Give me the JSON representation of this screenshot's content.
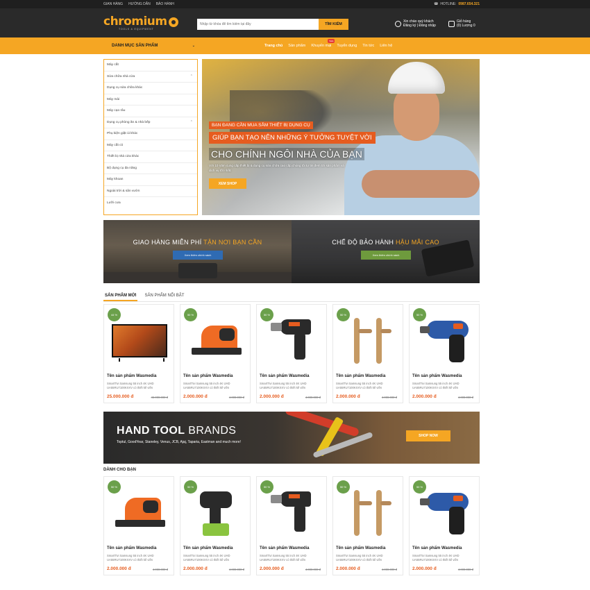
{
  "topbar": {
    "links": [
      "GIAN HÀNG",
      "HƯỚNG DẪN",
      "BẢO HÀNH"
    ],
    "hotline_label": "HOTLINE:",
    "hotline_number": "0987.654.321"
  },
  "header": {
    "logo_text": "chromium",
    "logo_tagline": "TOOLS & EQUIPMENT",
    "search_placeholder": "Nhập từ khóa để tìm kiếm tại đây",
    "search_button": "TÌM KIẾM",
    "account_line1": "Xin chào quý khách",
    "account_line2": "Đăng ký | Đăng nhập",
    "cart_line1": "Giỏ hàng",
    "cart_line2": "(0) Lượng 0"
  },
  "nav": {
    "category_label": "DANH MỤC SẢN PHẨM",
    "menu": [
      "Trang chủ",
      "Sản phẩm",
      "Khuyến mại",
      "Tuyển dụng",
      "Tin tức",
      "Liên hệ"
    ],
    "promo_badge": "Sale"
  },
  "categories": [
    {
      "label": "Máy cắt",
      "expandable": false
    },
    {
      "label": "Sửa chữa nhà cửa",
      "expandable": true
    },
    {
      "label": "Dụng cụ sửa chữa khác",
      "expandable": false
    },
    {
      "label": "Máy mài",
      "expandable": false
    },
    {
      "label": "Máy cạo râu",
      "expandable": false
    },
    {
      "label": "Dụng cụ phòng ăn & nhà bếp",
      "expandable": true
    },
    {
      "label": "Phụ kiện giặt ủi khác",
      "expandable": false
    },
    {
      "label": "Máy cắt cỏ",
      "expandable": false
    },
    {
      "label": "Thiết bị nhà cửa khác",
      "expandable": false
    },
    {
      "label": "Bộ dụng cụ đa năng",
      "expandable": false
    },
    {
      "label": "Máy khoan",
      "expandable": false
    },
    {
      "label": "Ngoài trời & sân vườn",
      "expandable": false
    },
    {
      "label": "Lưỡi cưa",
      "expandable": false
    }
  ],
  "hero": {
    "caption1": "BẠN ĐANG CẦN MUA SẮM THIẾT BỊ DỤNG CỤ",
    "caption2": "GIÚP BẠN TẠO NÊN NHỮNG Ý TƯỞNG TUYỆT VỜI",
    "caption3": "CHO CHÍNH NGÔI NHÀ CỦA BẠN",
    "description": "Với 10 năm cung cấp thiết bị & dụng cụ sửa chữa cao cấp,chúng tôi tự tin đem tới sản phẩm và dịch vụ tốt nhất.",
    "button": "XEM SHOP"
  },
  "banners": [
    {
      "title_plain": "GIAO HÀNG MIỄN PHÍ ",
      "title_accent": "TẬN NƠI BẠN CẦN",
      "button": "Xem thêm chính sách"
    },
    {
      "title_plain": "CHẾ ĐỘ BẢO HÀNH ",
      "title_accent": "HẬU MÃI CAO",
      "button": "Xem thêm chính sách"
    }
  ],
  "tabs": [
    "SẢN PHẨM MỚI",
    "SẢN PHẨM NỔI BẬT"
  ],
  "products_new": [
    {
      "discount": "44 %",
      "name": "Tên sản phẩm Wasmedia",
      "desc": "SmartTivi Samsung 55 inch 4K UHD UA55RU7100KXXV có thiết kế viền",
      "price": "25.000.000 đ",
      "old_price": "45.000.000 đ",
      "pic": "tv"
    },
    {
      "discount": "50 %",
      "name": "Tên sản phẩm Wasmedia",
      "desc": "SmartTivi Samsung 55 inch 4K UHD UA55RU7100KXXV có thiết kế viền",
      "price": "2.000.000 đ",
      "old_price": "4.000.000 đ",
      "pic": "planer"
    },
    {
      "discount": "50 %",
      "name": "Tên sản phẩm Wasmedia",
      "desc": "SmartTivi Samsung 55 inch 4K UHD UA55RU7100KXXV có thiết kế viền",
      "price": "2.000.000 đ",
      "old_price": "4.000.000 đ",
      "pic": "drill"
    },
    {
      "discount": "50 %",
      "name": "Tên sản phẩm Wasmedia",
      "desc": "SmartTivi Samsung 55 inch 4K UHD UA55RU7100KXXV có thiết kế viền",
      "price": "2.000.000 đ",
      "old_price": "4.000.000 đ",
      "pic": "key"
    },
    {
      "discount": "50 %",
      "name": "Tên sản phẩm Wasmedia",
      "desc": "SmartTivi Samsung 55 inch 4K UHD UA55RU7100KXXV có thiết kế viền",
      "price": "2.000.000 đ",
      "old_price": "4.000.000 đ",
      "pic": "screw"
    }
  ],
  "hand_banner": {
    "title_bold": "HAND TOOL",
    "title_light": " BRANDS",
    "subtitle": "Toptul, GoodYear, Staneley, Venus, JCB, Ajaj, Taparia, Eastman and much more!",
    "button": "SHOP NOW"
  },
  "section_for_you": "DÀNH CHO BẠN",
  "products_for_you": [
    {
      "discount": "50 %",
      "name": "Tên sản phẩm Wasmedia",
      "desc": "SmartTivi Samsung 55 inch 4K UHD UA55RU7100KXXV có thiết kế viền",
      "price": "2.000.000 đ",
      "old_price": "4.000.000 đ",
      "pic": "planer"
    },
    {
      "discount": "50 %",
      "name": "Tên sản phẩm Wasmedia",
      "desc": "SmartTivi Samsung 55 inch 4K UHD UA55RU7100KXXV có thiết kế viền",
      "price": "2.000.000 đ",
      "old_price": "4.000.000 đ",
      "pic": "impact"
    },
    {
      "discount": "50 %",
      "name": "Tên sản phẩm Wasmedia",
      "desc": "SmartTivi Samsung 55 inch 4K UHD UA55RU7100KXXV có thiết kế viền",
      "price": "2.000.000 đ",
      "old_price": "4.000.000 đ",
      "pic": "drill"
    },
    {
      "discount": "50 %",
      "name": "Tên sản phẩm Wasmedia",
      "desc": "SmartTivi Samsung 55 inch 4K UHD UA55RU7100KXXV có thiết kế viền",
      "price": "2.000.000 đ",
      "old_price": "4.000.000 đ",
      "pic": "key"
    },
    {
      "discount": "50 %",
      "name": "Tên sản phẩm Wasmedia",
      "desc": "SmartTivi Samsung 55 inch 4K UHD UA55RU7100KXXV có thiết kế viền",
      "price": "2.000.000 đ",
      "old_price": "4.000.000 đ",
      "pic": "screw"
    }
  ],
  "colors": {
    "brand_orange": "#f5a623",
    "accent_red_orange": "#e65c1f",
    "discount_green": "#6ba04b",
    "dark_bg": "#2a2a2a"
  }
}
